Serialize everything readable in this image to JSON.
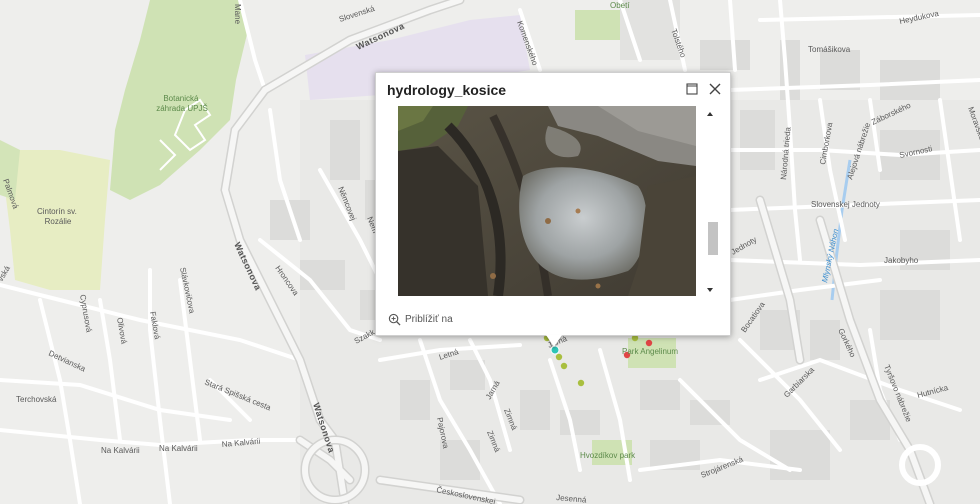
{
  "map": {
    "streets": {
      "watsonova_1": "Watsonova",
      "watsonova_2": "Watsonova",
      "watsonova_3": "Watsonova",
      "slovenska": "Slovenská",
      "mane": "Mane",
      "komenskeho": "Komenského",
      "tolsteho": "Tolstého",
      "tomasikova": "Tomášikova",
      "heydukova": "Heydukova",
      "narodna_trieda": "Národná trieda",
      "cimborkova": "Cimborkova",
      "alejova": "Alejová nábrežie",
      "zaborskeho": "Záborského",
      "svornosti": "Svornosti",
      "moravske": "Moravské",
      "slovenskej_jednoty": "Slovenskej Jednoty",
      "jednoty": "Jednoty",
      "jakobyho": "Jakobyho",
      "bocatiova": "Bocatiova",
      "gorkeho": "Gorkého",
      "garbiarska": "Garbiarska",
      "hutnicka": "Hutnícka",
      "tyrsovo": "Tyršovo nábrežie",
      "strojarenska": "Strojárenská",
      "ceskoslovenskej": "Československej",
      "jesenna": "Jesenná",
      "nemcovej": "Němcovej",
      "hroncova": "Hroncova",
      "letna": "Letná",
      "jarna": "Jarná",
      "jarna2": "Jarná",
      "zimna": "Zimná",
      "zimna2": "Zimná",
      "pajorova": "Pajorova",
      "szakk": "Szakk",
      "cyprusova": "Cyprusová",
      "olivova": "Olivová",
      "faklova": "Faklová",
      "slavkovicova": "Slávkovičova",
      "detvianska": "Detvianska",
      "terchovska": "Terchovská",
      "spisska": "Stará Spišská cesta",
      "kalvarii1": "Na Kalvárii",
      "kalvarii2": "Na Kalvárii",
      "kalvarii3": "Na Kalvárii",
      "palmova": "Palmová",
      "vska": "vská",
      "nem": "Nem"
    },
    "areas": {
      "botanical": "Botanická\nzáhrada UPJŠ",
      "cemetery": "Cintorín sv.\nRozálie",
      "park_angelinum": "Park Angelinum",
      "hvozdikov_park": "Hvozdíkov park",
      "obeti": "Obetí"
    },
    "water": {
      "river": "Mlynský Náhon"
    },
    "colors": {
      "background": "#eeeeec",
      "park": "#cfe2b4",
      "cemetery": "#e7edc3",
      "university": "#e6e0ee",
      "road": "#ffffff",
      "major_road": "#d9d9d9",
      "water": "#a8cdef",
      "marker_green": "#a9bf3f",
      "marker_red": "#e04545",
      "marker_selected": "#2ec4b6"
    }
  },
  "popup": {
    "title": "hydrology_kosice",
    "maximize_icon": "maximize-icon",
    "close_icon": "close-icon",
    "zoom_icon": "zoom-in-icon",
    "zoom_label": "Priblížiť na"
  }
}
